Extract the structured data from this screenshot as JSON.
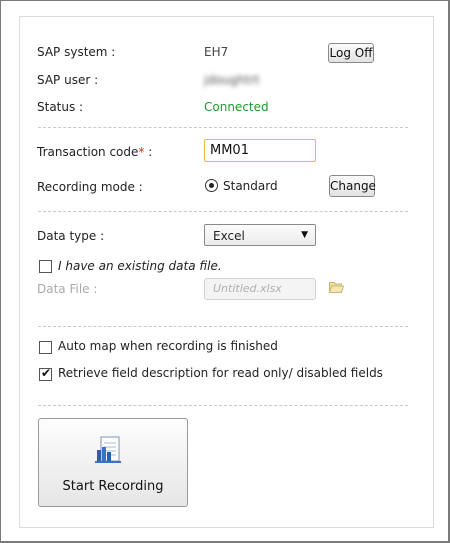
{
  "connection": {
    "sap_system_label": "SAP system :",
    "sap_system_value": "EH7",
    "log_off_label": "Log Off",
    "sap_user_label": "SAP user :",
    "sap_user_value": "jdoughtrt",
    "status_label": "Status :",
    "status_value": "Connected",
    "status_color": "#1e9c2e"
  },
  "transaction": {
    "label": "Transaction code",
    "required_mark": "*",
    "label_suffix": " :",
    "value": "MM01",
    "input_border_color": "#e8b84a"
  },
  "recording_mode": {
    "label": "Recording mode :",
    "option": "Standard",
    "selected": true,
    "change_label": "Change"
  },
  "data": {
    "type_label": "Data type :",
    "type_value": "Excel",
    "existing_file_label": "I have an existing data file.",
    "existing_file_checked": false,
    "file_label": "Data File :",
    "file_placeholder": "Untitled.xlsx",
    "folder_icon": "folder-open-icon"
  },
  "options": {
    "auto_map_label": "Auto map when recording is finished",
    "auto_map_checked": false,
    "retrieve_desc_label": "Retrieve field description for read only/ disabled fields",
    "retrieve_desc_checked": true
  },
  "start": {
    "label": "Start Recording",
    "icon": "recording-document-icon"
  }
}
